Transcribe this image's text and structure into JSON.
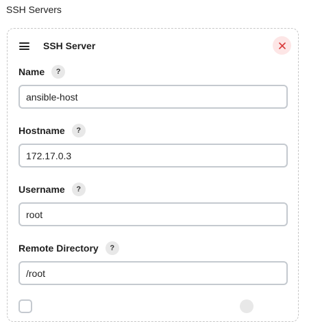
{
  "section": {
    "title": "SSH Servers"
  },
  "card": {
    "title": "SSH Server",
    "delete_icon": "close-icon",
    "handle_icon": "drag-handle-icon"
  },
  "fields": {
    "name": {
      "label": "Name",
      "value": "ansible-host",
      "help": "?"
    },
    "hostname": {
      "label": "Hostname",
      "value": "172.17.0.3",
      "help": "?"
    },
    "username": {
      "label": "Username",
      "value": "root",
      "help": "?"
    },
    "remote_directory": {
      "label": "Remote Directory",
      "value": "/root",
      "help": "?"
    }
  },
  "colors": {
    "delete_bg": "#fde6e6",
    "delete_icon": "#d93b3b",
    "input_border": "#c4c9cf",
    "help_bg": "#e8e8e8"
  }
}
